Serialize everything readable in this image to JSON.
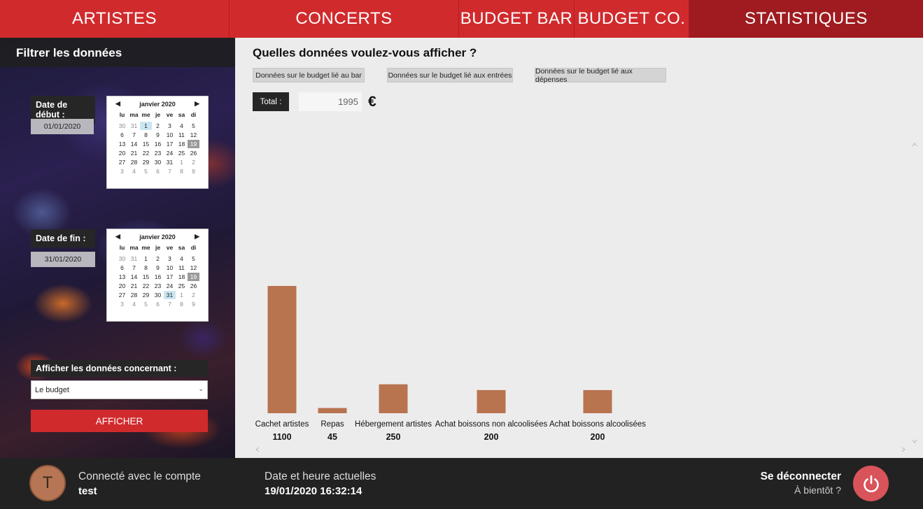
{
  "nav": {
    "tabs": [
      {
        "label": "ARTISTES"
      },
      {
        "label": "CONCERTS"
      },
      {
        "label": "BUDGET BAR"
      },
      {
        "label": "BUDGET CO."
      },
      {
        "label": "STATISTIQUES",
        "active": true
      }
    ]
  },
  "sidebar": {
    "title": "Filtrer les données",
    "start": {
      "label": "Date de début :",
      "value": "01/01/2020",
      "calendar": {
        "month": "janvier 2020",
        "day_headers": [
          "lu",
          "ma",
          "me",
          "je",
          "ve",
          "sa",
          "di"
        ],
        "days": [
          "30",
          "31",
          "1",
          "2",
          "3",
          "4",
          "5",
          "6",
          "7",
          "8",
          "9",
          "10",
          "11",
          "12",
          "13",
          "14",
          "15",
          "16",
          "17",
          "18",
          "19",
          "20",
          "21",
          "22",
          "23",
          "24",
          "25",
          "26",
          "27",
          "28",
          "29",
          "30",
          "31",
          "1",
          "2",
          "3",
          "4",
          "5",
          "6",
          "7",
          "8",
          "9"
        ],
        "selected": "1",
        "today": "19"
      }
    },
    "end": {
      "label": "Date de fin :",
      "value": "31/01/2020",
      "calendar": {
        "month": "janvier 2020",
        "day_headers": [
          "lu",
          "ma",
          "me",
          "je",
          "ve",
          "sa",
          "di"
        ],
        "days": [
          "30",
          "31",
          "1",
          "2",
          "3",
          "4",
          "5",
          "6",
          "7",
          "8",
          "9",
          "10",
          "11",
          "12",
          "13",
          "14",
          "15",
          "16",
          "17",
          "18",
          "19",
          "20",
          "21",
          "22",
          "23",
          "24",
          "25",
          "26",
          "27",
          "28",
          "29",
          "30",
          "31",
          "1",
          "2",
          "3",
          "4",
          "5",
          "6",
          "7",
          "8",
          "9"
        ],
        "selected": "31",
        "today": "19"
      }
    },
    "concern_label": "Afficher les données concernant :",
    "concern_value": "Le budget",
    "show_button": "AFFICHER"
  },
  "main": {
    "question": "Quelles données voulez-vous afficher ?",
    "options": [
      "Données sur le budget lié au bar",
      "Données sur le budget lié aux entrées",
      "Données sur le budget lié aux dépenses"
    ],
    "total_label": "Total :",
    "total_value": "1995",
    "currency": "€"
  },
  "chart_data": {
    "type": "bar",
    "categories": [
      "Cachet artistes",
      "Repas",
      "Hébergement artistes",
      "Achat boissons non alcoolisées",
      "Achat boissons alcoolisées"
    ],
    "values": [
      1100,
      45,
      250,
      200,
      200
    ],
    "bar_color": "#b8734f",
    "grid": false,
    "title": "",
    "xlabel": "",
    "ylabel": ""
  },
  "footer": {
    "avatar_letter": "T",
    "account_label": "Connecté avec le compte",
    "account_name": "test",
    "datetime_label": "Date et heure actuelles",
    "datetime_value": "19/01/2020 16:32:14",
    "logout_title": "Se déconnecter",
    "logout_sub": "À bientôt ?"
  },
  "colors": {
    "accent": "#d12a2d",
    "accent_active": "#9f1b1f",
    "bar": "#b8734f",
    "power": "#d9535a"
  }
}
